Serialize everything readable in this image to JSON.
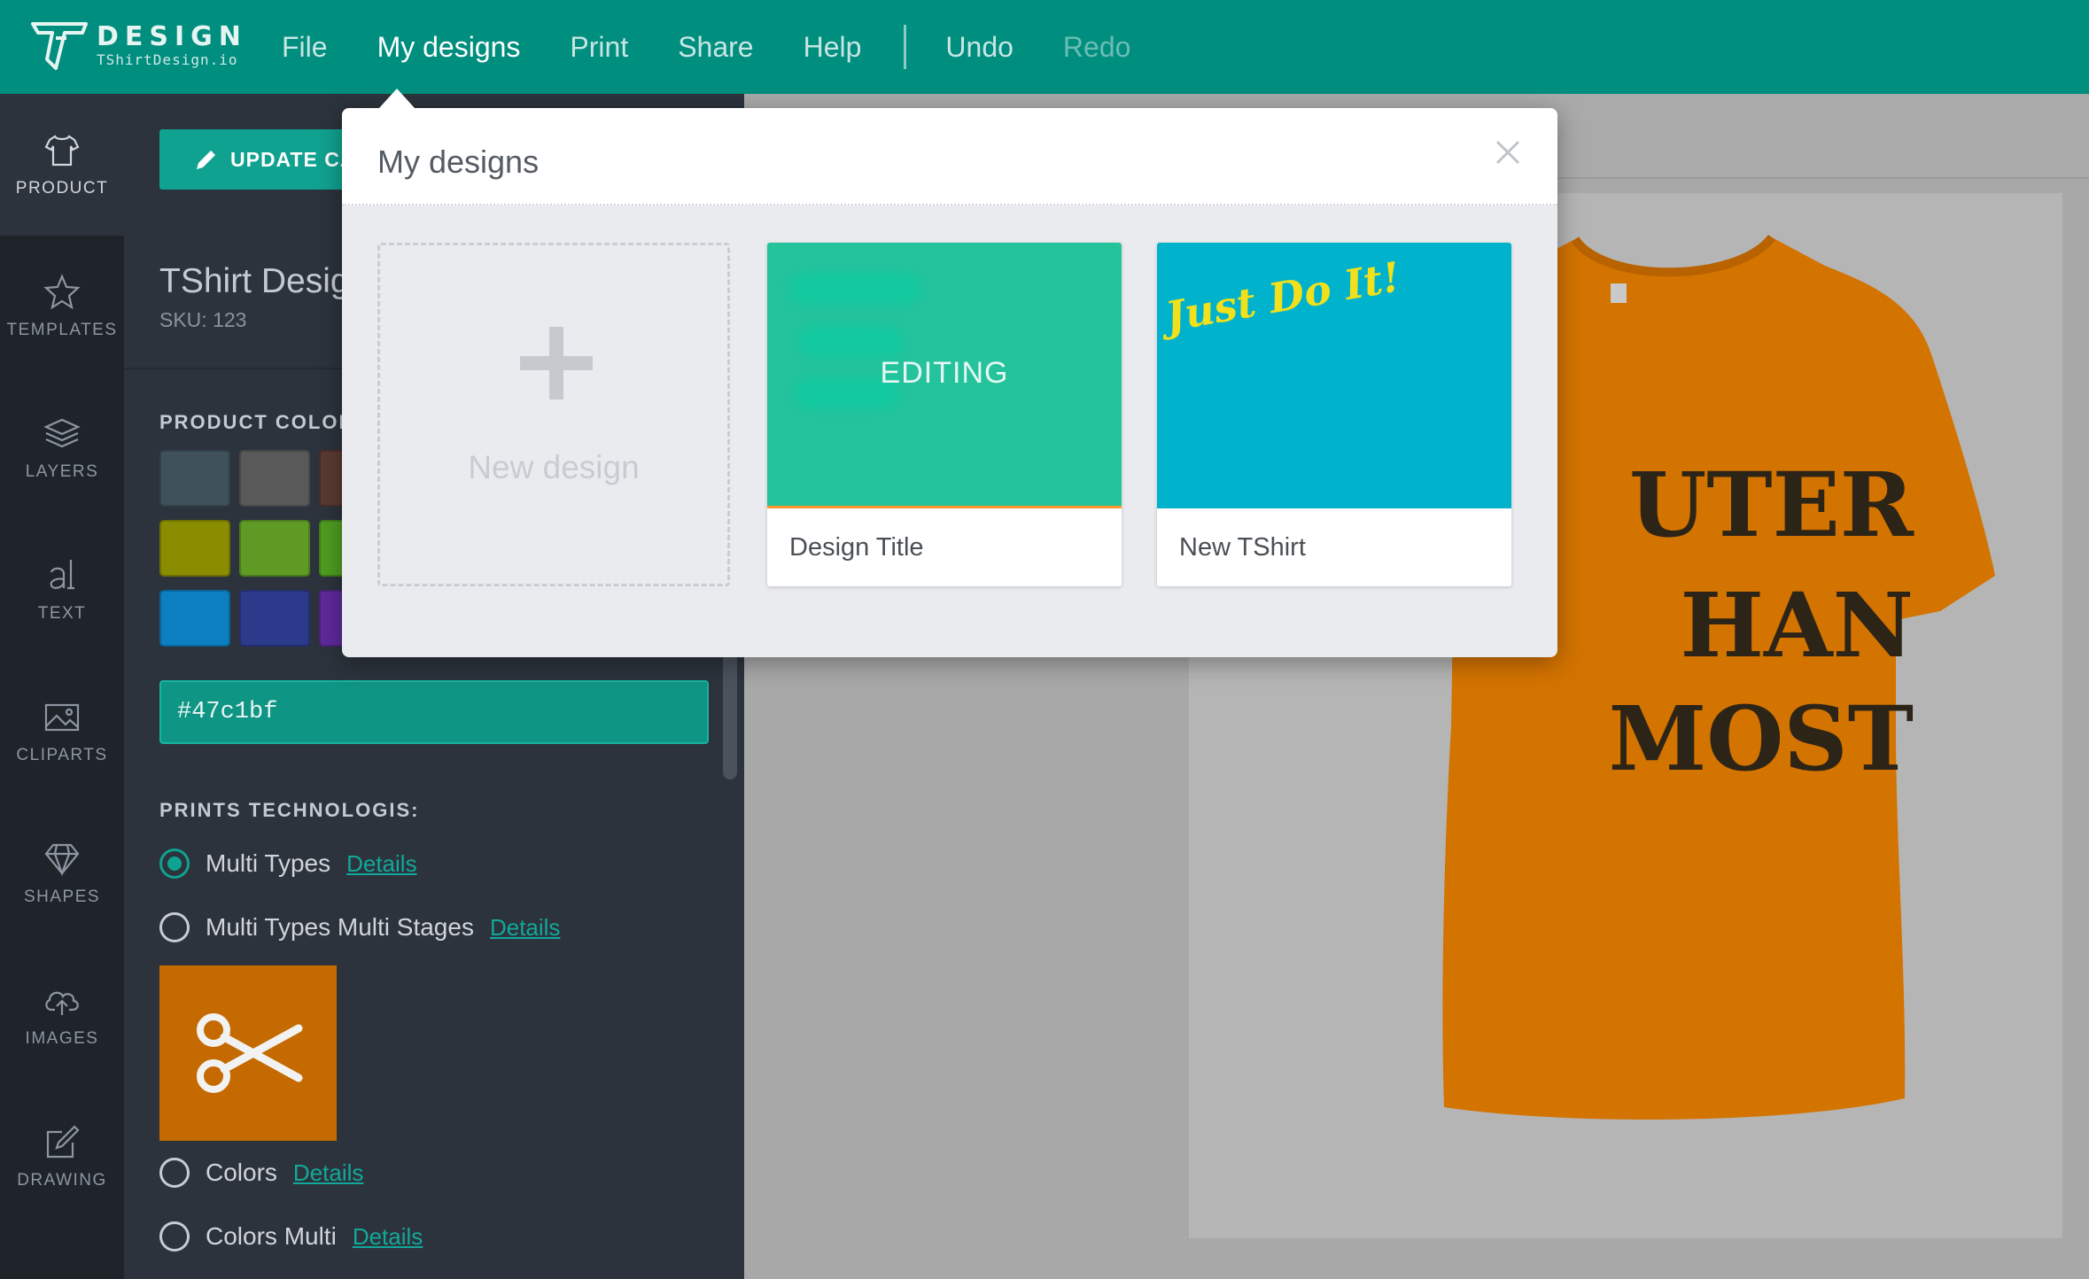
{
  "app": {
    "logo_main": "DESIGN",
    "logo_sub": "TShirtDesign.io",
    "brand_color": "#008e7e"
  },
  "menu": {
    "file": "File",
    "my_designs": "My designs",
    "print": "Print",
    "share": "Share",
    "help": "Help",
    "undo": "Undo",
    "redo": "Redo"
  },
  "rail": {
    "items": [
      {
        "label": "PRODUCT",
        "icon": "tshirt-icon"
      },
      {
        "label": "TEMPLATES",
        "icon": "star-icon"
      },
      {
        "label": "LAYERS",
        "icon": "layers-icon"
      },
      {
        "label": "TEXT",
        "icon": "text-icon"
      },
      {
        "label": "CLIPARTS",
        "icon": "image-icon"
      },
      {
        "label": "SHAPES",
        "icon": "diamond-icon"
      },
      {
        "label": "IMAGES",
        "icon": "cloud-upload-icon"
      },
      {
        "label": "DRAWING",
        "icon": "edit-icon"
      }
    ]
  },
  "panel": {
    "update_button": "UPDATE CA",
    "product_title": "TShirt Desig",
    "sku": "SKU: 123",
    "product_colors_label": "PRODUCT COLOR",
    "swatches": [
      "#3f525c",
      "#595959",
      "#5a3a32",
      "#8a8d00",
      "#5e9a24",
      "#4f9d20",
      "#0c7fc0",
      "#2c3a8c",
      "#5e2a9b"
    ],
    "color_value": "#47c1bf",
    "prints_label": "PRINTS TECHNOLOGIS:",
    "prints": [
      {
        "label": "Multi Types",
        "details": "Details",
        "checked": true
      },
      {
        "label": "Multi Types Multi Stages",
        "details": "Details",
        "checked": false
      },
      {
        "label": "Colors",
        "details": "Details",
        "checked": false
      },
      {
        "label": "Colors Multi",
        "details": "Details",
        "checked": false
      }
    ],
    "tech_preview_icon": "scissors-icon"
  },
  "canvas": {
    "shirt_color": "#d37300",
    "shirt_text": [
      "UTER",
      "HAN",
      "MOST"
    ]
  },
  "modal": {
    "title": "My designs",
    "new_design_label": "New design",
    "designs": [
      {
        "name": "Design Title",
        "status": "EDITING",
        "thumb_color": "#24c39c"
      },
      {
        "name": "New TShirt",
        "thumb_text": "Just Do It!",
        "thumb_color": "#00b2cc"
      }
    ]
  }
}
